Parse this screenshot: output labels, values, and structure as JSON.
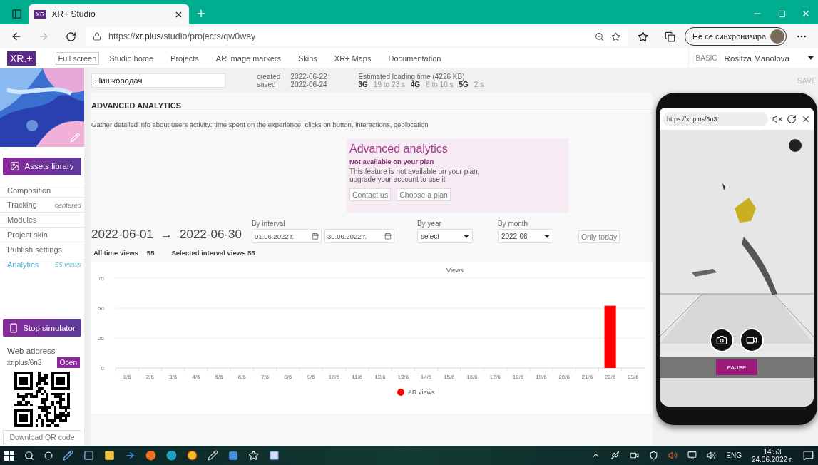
{
  "browser": {
    "tabs": [
      {
        "favicon": "XR",
        "title": "XR+ Studio",
        "selected": true
      }
    ],
    "url": "https://**xr.plus**/studio/projects/qw0way",
    "profile": "Не се синхронизира"
  },
  "site_nav": {
    "logo": "XR.+",
    "fullscreen": "Full screen",
    "links": [
      "Studio home",
      "Projects",
      "AR image markers",
      "Skins",
      "XR+ Maps",
      "Documentation"
    ],
    "plan": "BASIC",
    "user": "Rositza Manolova"
  },
  "project": {
    "name": "Нишководач",
    "created_label": "created",
    "created": "2022-06-22",
    "saved_label": "saved",
    "saved": "2022-06-24",
    "loading_title": "Estimated loading time (4226 KB)",
    "loading": [
      {
        "net": "3G",
        "time": "19 to 23 s"
      },
      {
        "net": "4G",
        "time": "8 to 10 s"
      },
      {
        "net": "5G",
        "time": "2 s"
      }
    ],
    "save": "SAVE"
  },
  "sidebar": {
    "assets_button": "Assets library",
    "items": [
      {
        "label": "Composition",
        "selected": false
      },
      {
        "label": "Tracking",
        "note": "centered",
        "selected": false
      },
      {
        "label": "Modules",
        "selected": false
      },
      {
        "label": "Project skin",
        "selected": false
      },
      {
        "label": "Publish settings",
        "selected": false
      },
      {
        "label": "Analytics",
        "note": "55 views",
        "selected": true
      }
    ],
    "simulator_button": "Stop simulator",
    "web_address_label": "Web address",
    "web_address": "xr.plus/6n3",
    "open_button": "Open",
    "download_qr": "Download QR code"
  },
  "analytics": {
    "heading": "ADVANCED ANALYTICS",
    "description": "Gather detailed info about users activity: time spent on the experience, clicks on button, interactions, geolocation",
    "upgrade": {
      "title": "Advanced analytics",
      "subtitle": "Not available on your plan",
      "text": "This feature is not available on your plan, upgrade your account to use it",
      "buttons": [
        "Contact us",
        "Choose a plan"
      ]
    },
    "range_from": "2022-06-01",
    "arrow": "→",
    "range_to": "2022-06-30",
    "interval_label": "By interval",
    "interval_from": "01.06.2022 г.",
    "interval_to": "30.06.2022 г.",
    "year_label": "By year",
    "year_value": "select",
    "month_label": "By month",
    "month_value": "2022-06",
    "only_today": "Only today",
    "all_time_label": "All time views",
    "all_time_value": "55",
    "selected_interval": "Selected interval views 55",
    "chart_data": {
      "type": "bar",
      "title": "Views",
      "categories": [
        "1/6",
        "2/6",
        "3/6",
        "4/6",
        "5/6",
        "6/6",
        "7/6",
        "8/6",
        "9/6",
        "10/6",
        "11/6",
        "12/6",
        "13/6",
        "14/6",
        "15/6",
        "16/6",
        "17/6",
        "18/6",
        "19/6",
        "20/6",
        "21/6",
        "22/6",
        "23/6"
      ],
      "series": [
        {
          "name": "AR views",
          "color": "#ff0000",
          "values": [
            0,
            0,
            0,
            0,
            0,
            0,
            0,
            0,
            0,
            0,
            0,
            0,
            0,
            0,
            0,
            0,
            0,
            0,
            0,
            0,
            0,
            52,
            0
          ]
        }
      ],
      "ylim": [
        0,
        75
      ],
      "yticks": [
        0,
        25,
        50,
        75
      ]
    }
  },
  "simulator": {
    "url": "https://xr.plus/6n3",
    "pause": "PAUSE"
  },
  "taskbar": {
    "language": "ENG",
    "time": "14:53",
    "date": "24.06.2022 г."
  }
}
